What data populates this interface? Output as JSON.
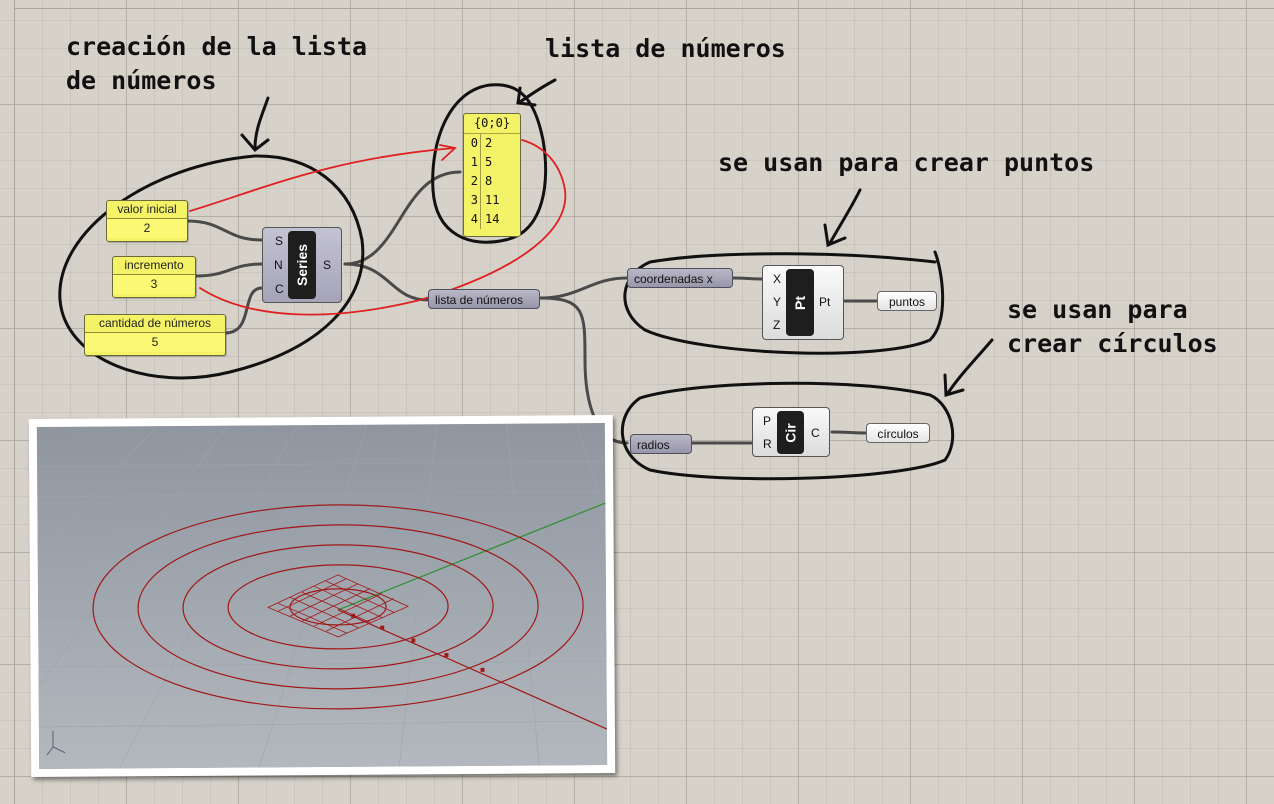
{
  "annotations": {
    "creation": "creación de la lista\nde números",
    "number_list": "lista de números",
    "points": "se usan para crear puntos",
    "circles": "se usan para\ncrear círculos"
  },
  "sliders": {
    "start": {
      "label": "valor inicial",
      "value": "2"
    },
    "step": {
      "label": "incremento",
      "value": "3"
    },
    "count": {
      "label": "cantidad de números",
      "value": "5"
    }
  },
  "series": {
    "name": "Series",
    "inputs": [
      "S",
      "N",
      "C"
    ],
    "output": "S"
  },
  "panel": {
    "path": "{0;0}",
    "indices": [
      "0",
      "1",
      "2",
      "3",
      "4"
    ],
    "values": [
      "2",
      "5",
      "8",
      "11",
      "14"
    ]
  },
  "relay": {
    "label": "lista de números"
  },
  "point_group": {
    "coord_param": "coordenadas x",
    "component": "Pt",
    "inputs": [
      "X",
      "Y",
      "Z"
    ],
    "output": "Pt",
    "result": "puntos"
  },
  "circle_group": {
    "radius_param": "radios",
    "component": "Cir",
    "inputs": [
      "P",
      "R"
    ],
    "output": "C",
    "result": "círculos"
  },
  "colors": {
    "canvas": "#d6d2ca",
    "panel_yellow": "#f4f266",
    "annotation_ink": "#111111",
    "sketch_red": "#e02020",
    "geometry_red": "#a01818",
    "axis_green": "#2f8f2f"
  }
}
